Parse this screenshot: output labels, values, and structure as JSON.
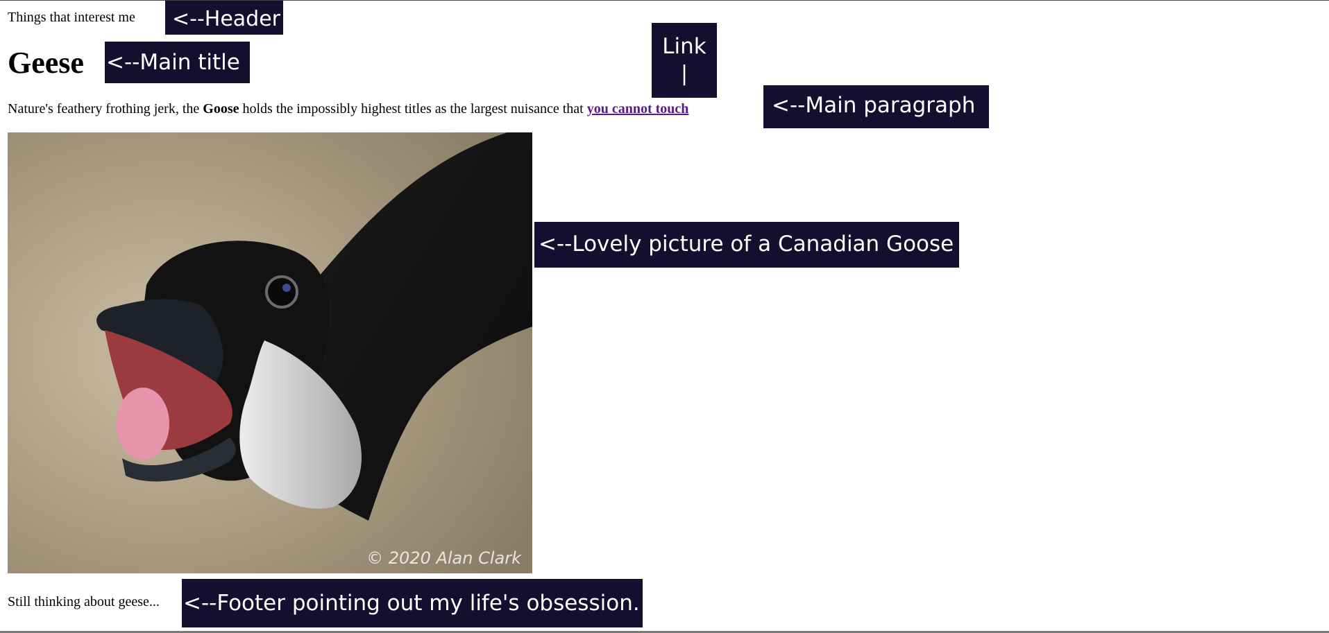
{
  "header": {
    "text": "Things that interest me"
  },
  "main": {
    "title": "Geese",
    "paragraph": {
      "before_bold": "Nature's feathery frothing jerk, the ",
      "bold": "Goose",
      "after_bold": " holds the impossibly highest titles as the largest nuisance that ",
      "link_text": "you cannot touch"
    },
    "image": {
      "credit": "© 2020 Alan Clark"
    }
  },
  "footer": {
    "text": "Still thinking about geese..."
  },
  "annotations": {
    "header": "<--Header",
    "main_title": "<--Main title",
    "link_top": "Link",
    "link_stem": "|",
    "main_paragraph": "<--Main paragraph",
    "picture": "<--Lovely picture of a Canadian Goose",
    "footer": "<--Footer pointing out my life's obsession."
  },
  "colors": {
    "label_background": "#130f2e",
    "label_text": "#ffffff",
    "link_visited": "#551a8b"
  }
}
